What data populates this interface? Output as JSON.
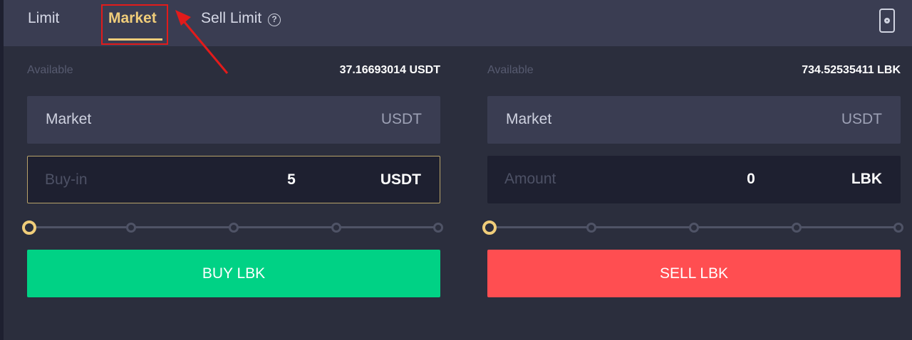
{
  "tabs": {
    "limit": "Limit",
    "market": "Market",
    "sell_limit": "Sell Limit",
    "help_glyph": "?",
    "active": "market"
  },
  "buy": {
    "available_label": "Available",
    "available_value": "37.16693014 USDT",
    "price_label": "Market",
    "price_unit": "USDT",
    "amount_placeholder": "Buy-in",
    "amount_value": "5",
    "amount_unit": "USDT",
    "slider_fraction": 0,
    "button_label": "BUY LBK"
  },
  "sell": {
    "available_label": "Available",
    "available_value": "734.52535411 LBK",
    "price_label": "Market",
    "price_unit": "USDT",
    "amount_placeholder": "Amount",
    "amount_value": "0",
    "amount_unit": "LBK",
    "slider_fraction": 0,
    "button_label": "SELL LBK"
  },
  "icons": {
    "settings": "settings-icon",
    "help": "help-icon"
  },
  "colors": {
    "accent": "#f0cd7a",
    "buy": "#00d285",
    "sell": "#ff4e51",
    "annotation": "#e21b1b"
  }
}
